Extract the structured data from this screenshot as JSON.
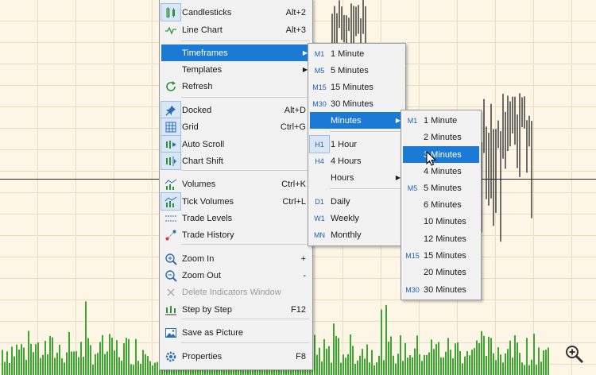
{
  "main_menu": [
    {
      "id": "candlesticks",
      "icon": "candlesticks-icon",
      "label": "Candlesticks",
      "shortcut": "Alt+2",
      "checked": true
    },
    {
      "id": "line-chart",
      "icon": "line-chart-icon",
      "label": "Line Chart",
      "shortcut": "Alt+3"
    },
    {
      "id": "timeframes",
      "icon": "",
      "label": "Timeframes",
      "submenu": true,
      "selected": true
    },
    {
      "id": "templates",
      "icon": "",
      "label": "Templates",
      "submenu": true
    },
    {
      "id": "refresh",
      "icon": "refresh-icon",
      "label": "Refresh"
    },
    {
      "id": "docked",
      "icon": "pin-icon",
      "label": "Docked",
      "shortcut": "Alt+D",
      "checked": true
    },
    {
      "id": "grid",
      "icon": "grid-icon",
      "label": "Grid",
      "shortcut": "Ctrl+G",
      "checked": true
    },
    {
      "id": "auto-scroll",
      "icon": "auto-scroll-icon",
      "label": "Auto Scroll",
      "checked": true
    },
    {
      "id": "chart-shift",
      "icon": "chart-shift-icon",
      "label": "Chart Shift",
      "checked": true
    },
    {
      "id": "volumes",
      "icon": "volumes-icon",
      "label": "Volumes",
      "shortcut": "Ctrl+K"
    },
    {
      "id": "tick-volumes",
      "icon": "tick-volumes-icon",
      "label": "Tick Volumes",
      "shortcut": "Ctrl+L",
      "checked": true
    },
    {
      "id": "trade-levels",
      "icon": "trade-levels-icon",
      "label": "Trade Levels"
    },
    {
      "id": "trade-history",
      "icon": "trade-history-icon",
      "label": "Trade History"
    },
    {
      "id": "zoom-in",
      "icon": "zoom-in-icon",
      "label": "Zoom In",
      "shortcut": "+"
    },
    {
      "id": "zoom-out",
      "icon": "zoom-out-icon",
      "label": "Zoom Out",
      "shortcut": "-"
    },
    {
      "id": "delete-indicators-window",
      "icon": "delete-icon",
      "label": "Delete Indicators Window",
      "disabled": true
    },
    {
      "id": "step-by-step",
      "icon": "step-icon",
      "label": "Step by Step",
      "shortcut": "F12"
    },
    {
      "id": "save-as-picture",
      "icon": "picture-icon",
      "label": "Save as Picture"
    },
    {
      "id": "properties",
      "icon": "properties-icon",
      "label": "Properties",
      "shortcut": "F8"
    }
  ],
  "timeframes_menu": [
    {
      "tag": "M1",
      "label": "1 Minute"
    },
    {
      "tag": "M5",
      "label": "5 Minutes"
    },
    {
      "tag": "M15",
      "label": "15 Minutes"
    },
    {
      "tag": "M30",
      "label": "30 Minutes"
    },
    {
      "tag": "",
      "label": "Minutes",
      "submenu": true,
      "selected": true
    },
    {
      "tag": "H1",
      "label": "1 Hour",
      "checked": true
    },
    {
      "tag": "H4",
      "label": "4 Hours"
    },
    {
      "tag": "",
      "label": "Hours",
      "submenu": true
    },
    {
      "tag": "D1",
      "label": "Daily"
    },
    {
      "tag": "W1",
      "label": "Weekly"
    },
    {
      "tag": "MN",
      "label": "Monthly"
    }
  ],
  "minutes_menu": [
    {
      "tag": "M1",
      "label": "1 Minute"
    },
    {
      "tag": "",
      "label": "2 Minutes"
    },
    {
      "tag": "",
      "label": "3 Minutes",
      "selected": true
    },
    {
      "tag": "",
      "label": "4 Minutes"
    },
    {
      "tag": "M5",
      "label": "5 Minutes"
    },
    {
      "tag": "",
      "label": "6 Minutes"
    },
    {
      "tag": "",
      "label": "10 Minutes"
    },
    {
      "tag": "",
      "label": "12 Minutes"
    },
    {
      "tag": "M15",
      "label": "15 Minutes"
    },
    {
      "tag": "",
      "label": "20 Minutes"
    },
    {
      "tag": "M30",
      "label": "30 Minutes"
    }
  ],
  "colors": {
    "chart_bg": "#fdf6e6",
    "grid": "#e9dcc0",
    "volume_bar": "#3aa82e",
    "candle": "#222222",
    "accent": "#1a7ad6"
  }
}
